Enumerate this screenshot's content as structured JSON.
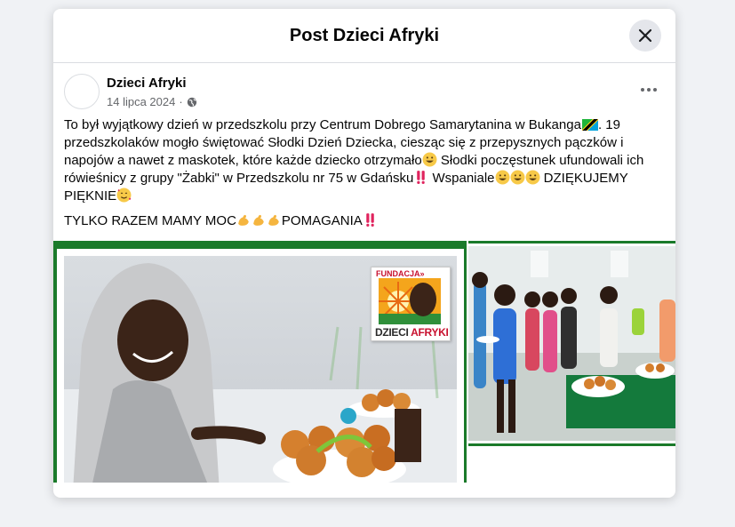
{
  "modal": {
    "title": "Post Dzieci Afryki",
    "close_icon": "close-icon"
  },
  "post": {
    "author": "Dzieci Afryki",
    "date": "14 lipca 2024",
    "separator": "·",
    "audience_icon": "globe-icon",
    "more_icon": "more-options-icon",
    "text_1": "To był wyjątkowy dzień w przedszkolu przy Centrum Dobrego Samarytanina w Bukanga",
    "text_2": ". 19 przedszkolaków mogło świętować Słodki Dzień Dziecka, ciesząc się z przepysznych pączków i napojów a nawet z maskotek, które każde dziecko otrzymało",
    "text_3": " Słodki poczęstunek ufundowali ich rówieśnicy z grupy \"Żabki\" w Przedszkolu nr 75 w Gdańsku",
    "text_4": " Wspaniale",
    "text_5": "  DZIĘKUJEMY PIĘKNIE",
    "line2_a": "TYLKO RAZEM MAMY MOC",
    "line2_b": "POMAGANIA"
  },
  "images": {
    "logo_top": "FUNDACJA»",
    "logo_word_1": "DZIECI",
    "logo_word_2": "AFRYKI"
  },
  "colors": {
    "brand_green": "#1a7a2a",
    "logo_red": "#c8102e"
  }
}
